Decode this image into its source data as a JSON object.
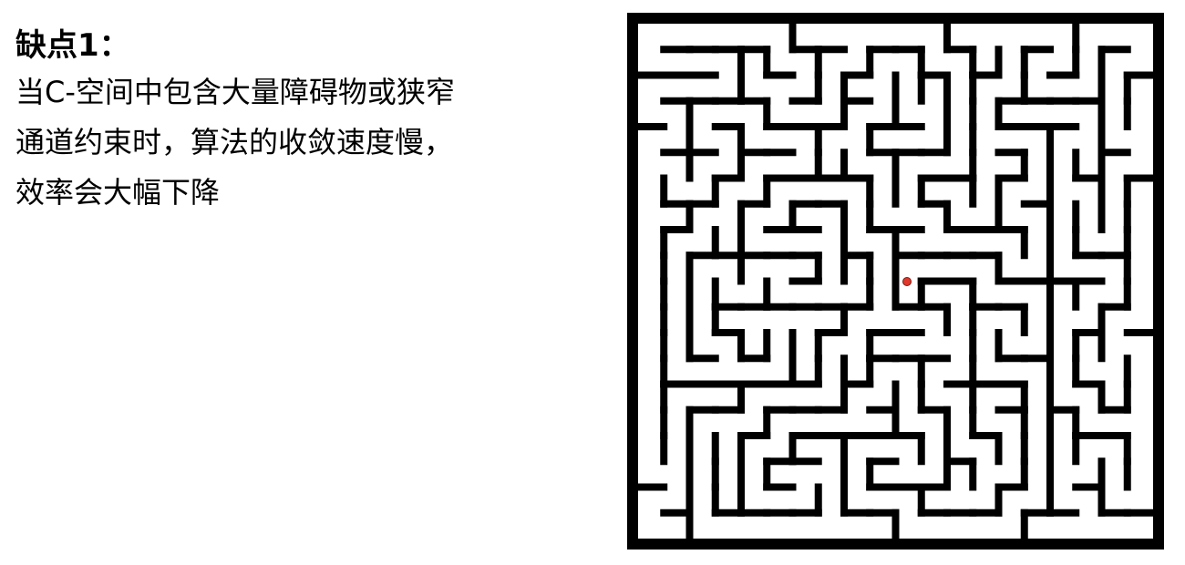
{
  "text": {
    "heading": "缺点1：",
    "lines": [
      "当C-空间中包含大量障碍物或狭窄",
      "通道约束时，算法的收敛速度慢，",
      "效率会大幅下降"
    ]
  },
  "maze": {
    "wall_color": "#000000",
    "background_color": "#ffffff",
    "marker_color": "#e0382b",
    "marker_outline_color": "#7a1a14"
  }
}
